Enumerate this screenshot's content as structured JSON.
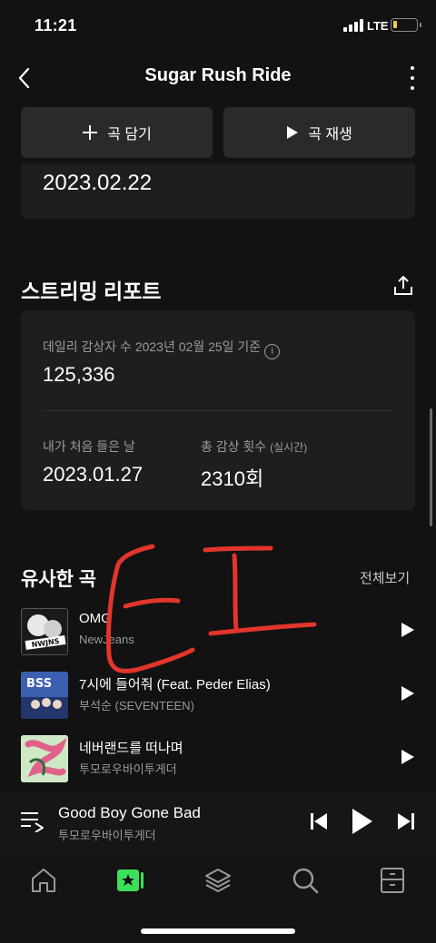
{
  "status_bar": {
    "time": "11:21",
    "network": "LTE"
  },
  "header": {
    "title": "Sugar Rush Ride"
  },
  "actions": {
    "add_label": "곡 담기",
    "play_label": "곡 재생"
  },
  "release": {
    "date": "2023.02.22"
  },
  "report": {
    "title": "스트리밍 리포트",
    "daily_label": "데일리 감상자 수 2023년 02월 25일 기준",
    "daily_value": "125,336",
    "first_listen_label": "내가 처음 들은 날",
    "first_listen_value": "2023.01.27",
    "total_label": "총 감상 횟수",
    "total_sub": "(실시간)",
    "total_value": "2310회"
  },
  "similar": {
    "title": "유사한 곡",
    "see_all": "전체보기",
    "songs": [
      {
        "title": "OMG",
        "artist": "NewJeans",
        "art_text": "NWJNS"
      },
      {
        "title": "7시에 들어줘 (Feat. Peder Elias)",
        "artist": "부석순 (SEVENTEEN)",
        "art_text": "BSS"
      },
      {
        "title": "네버랜드를 떠나며",
        "artist": "투모로우바이투게더",
        "art_text": ""
      }
    ]
  },
  "now_playing": {
    "title": "Good Boy Gone Bad",
    "artist": "투모로우바이투게더"
  },
  "tabs": [
    "home-icon",
    "chart-icon",
    "layers-icon",
    "search-icon",
    "library-icon"
  ],
  "colors": {
    "accent": "#3de05a",
    "overlay": "#e2352b",
    "background": "#121212",
    "card": "#1e1e1e"
  }
}
